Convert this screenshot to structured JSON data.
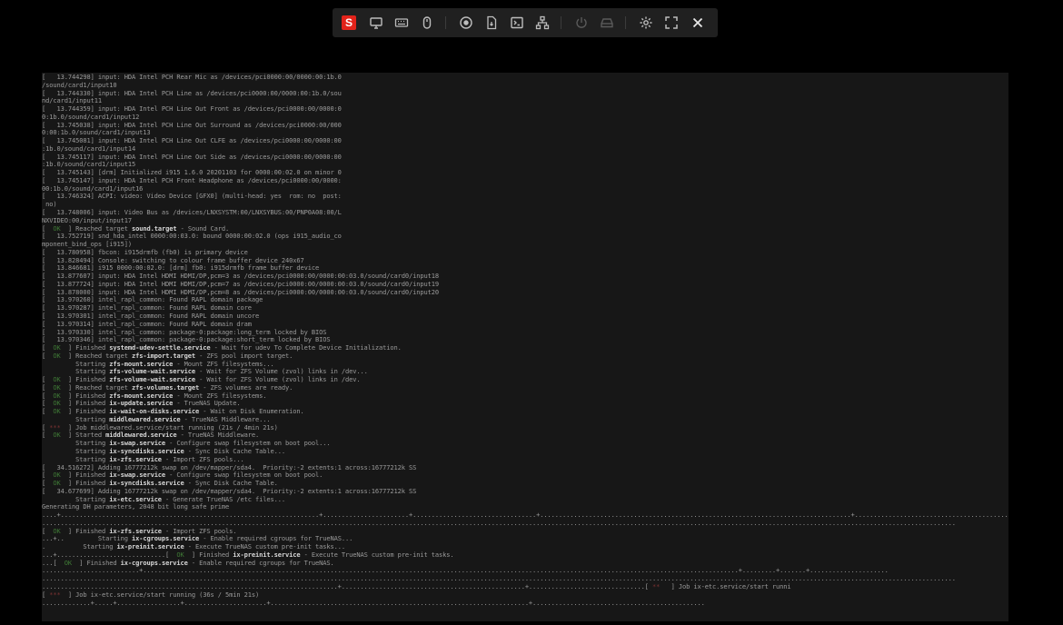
{
  "toolbar": {
    "logo_letter": "S",
    "buttons": [
      "display-icon",
      "keyboard-icon",
      "mouse-icon",
      "record-icon",
      "file-transfer-icon",
      "terminal-icon",
      "network-icon",
      "power-icon",
      "drive-icon",
      "settings-icon",
      "fullscreen-icon",
      "close-icon"
    ]
  },
  "colors": {
    "console_bg": "#171717",
    "console_text": "#9a9a9a",
    "ok_green": "#3f7a36",
    "wait_red": "#7a3232",
    "logo_red": "#e2231a"
  },
  "console": {
    "lines": [
      [
        {
          "t": "[   13.744298] input: HDA Intel PCH Rear Mic as /devices/pci0000:00/0000:00:1b.0"
        }
      ],
      [
        {
          "t": "/sound/card1/input10"
        }
      ],
      [
        {
          "t": "[   13.744330] input: HDA Intel PCH Line as /devices/pci0000:00/0000:00:1b.0/sou"
        }
      ],
      [
        {
          "t": "nd/card1/input11"
        }
      ],
      [
        {
          "t": "[   13.744359] input: HDA Intel PCH Line Out Front as /devices/pci0000:00/0000:0"
        }
      ],
      [
        {
          "t": "0:1b.0/sound/card1/input12"
        }
      ],
      [
        {
          "t": "[   13.745038] input: HDA Intel PCH Line Out Surround as /devices/pci0000:00/000"
        }
      ],
      [
        {
          "t": "0:00:1b.0/sound/card1/input13"
        }
      ],
      [
        {
          "t": "[   13.745081] input: HDA Intel PCH Line Out CLFE as /devices/pci0000:00/0000:00"
        }
      ],
      [
        {
          "t": ":1b.0/sound/card1/input14"
        }
      ],
      [
        {
          "t": "[   13.745117] input: HDA Intel PCH Line Out Side as /devices/pci0000:00/0000:00"
        }
      ],
      [
        {
          "t": ":1b.0/sound/card1/input15"
        }
      ],
      [
        {
          "t": "[   13.745143] [drm] Initialized i915 1.6.0 20201103 for 0000:00:02.0 on minor 0"
        }
      ],
      [
        {
          "t": "[   13.745147] input: HDA Intel PCH Front Headphone as /devices/pci0000:00/0000:"
        }
      ],
      [
        {
          "t": "00:1b.0/sound/card1/input16"
        }
      ],
      [
        {
          "t": "[   13.746324] ACPI: video: Video Device [GFX0] (multi-head: yes  rom: no  post:"
        }
      ],
      [
        {
          "t": " no)"
        }
      ],
      [
        {
          "t": "[   13.748006] input: Video Bus as /devices/LNXSYSTM:00/LNXSYBUS:00/PNP0A08:00/L"
        }
      ],
      [
        {
          "t": "NXVIDEO:00/input/input17"
        }
      ],
      [
        {
          "t": "[  "
        },
        {
          "t": "OK",
          "c": "ok"
        },
        {
          "t": "  ] Reached target "
        },
        {
          "t": "sound.target",
          "c": "b"
        },
        {
          "t": " - Sound Card."
        }
      ],
      [
        {
          "t": "[   13.752719] snd_hda_intel 0000:00:03.0: bound 0000:00:02.0 (ops i915_audio_co"
        }
      ],
      [
        {
          "t": "mponent_bind_ops [i915])"
        }
      ],
      [
        {
          "t": "[   13.780958] fbcon: i915drmfb (fb0) is primary device"
        }
      ],
      [
        {
          "t": "[   13.828494] Console: switching to colour frame buffer device 240x67"
        }
      ],
      [
        {
          "t": "[   13.846681] i915 0000:00:02.0: [drm] fb0: i915drmfb frame buffer device"
        }
      ],
      [
        {
          "t": "[   13.877607] input: HDA Intel HDMI HDMI/DP,pcm=3 as /devices/pci0000:00/0000:00:03.0/sound/card0/input18"
        }
      ],
      [
        {
          "t": "[   13.877724] input: HDA Intel HDMI HDMI/DP,pcm=7 as /devices/pci0000:00/0000:00:03.0/sound/card0/input19"
        }
      ],
      [
        {
          "t": "[   13.878000] input: HDA Intel HDMI HDMI/DP,pcm=8 as /devices/pci0000:00/0000:00:03.0/sound/card0/input20"
        }
      ],
      [
        {
          "t": "[   13.970260] intel_rapl_common: Found RAPL domain package"
        }
      ],
      [
        {
          "t": "[   13.970287] intel_rapl_common: Found RAPL domain core"
        }
      ],
      [
        {
          "t": "[   13.970301] intel_rapl_common: Found RAPL domain uncore"
        }
      ],
      [
        {
          "t": "[   13.970314] intel_rapl_common: Found RAPL domain dram"
        }
      ],
      [
        {
          "t": "[   13.970330] intel_rapl_common: package-0:package:long_term locked by BIOS"
        }
      ],
      [
        {
          "t": "[   13.970346] intel_rapl_common: package-0:package:short_term locked by BIOS"
        }
      ],
      [
        {
          "t": "[  "
        },
        {
          "t": "OK",
          "c": "ok"
        },
        {
          "t": "  ] Finished "
        },
        {
          "t": "systemd-udev-settle.service",
          "c": "b"
        },
        {
          "t": " - Wait for udev To Complete Device Initialization."
        }
      ],
      [
        {
          "t": "[  "
        },
        {
          "t": "OK",
          "c": "ok"
        },
        {
          "t": "  ] Reached target "
        },
        {
          "t": "zfs-import.target",
          "c": "b"
        },
        {
          "t": " - ZFS pool import target."
        }
      ],
      [
        {
          "t": "         Starting "
        },
        {
          "t": "zfs-mount.service",
          "c": "b"
        },
        {
          "t": " - Mount ZFS filesystems..."
        }
      ],
      [
        {
          "t": "         Starting "
        },
        {
          "t": "zfs-volume-wait.service",
          "c": "b"
        },
        {
          "t": " - Wait for ZFS Volume (zvol) links in /dev..."
        }
      ],
      [
        {
          "t": "[  "
        },
        {
          "t": "OK",
          "c": "ok"
        },
        {
          "t": "  ] Finished "
        },
        {
          "t": "zfs-volume-wait.service",
          "c": "b"
        },
        {
          "t": " - Wait for ZFS Volume (zvol) links in /dev."
        }
      ],
      [
        {
          "t": "[  "
        },
        {
          "t": "OK",
          "c": "ok"
        },
        {
          "t": "  ] Reached target "
        },
        {
          "t": "zfs-volumes.target",
          "c": "b"
        },
        {
          "t": " - ZFS volumes are ready."
        }
      ],
      [
        {
          "t": "[  "
        },
        {
          "t": "OK",
          "c": "ok"
        },
        {
          "t": "  ] Finished "
        },
        {
          "t": "zfs-mount.service",
          "c": "b"
        },
        {
          "t": " - Mount ZFS filesystems."
        }
      ],
      [
        {
          "t": "[  "
        },
        {
          "t": "OK",
          "c": "ok"
        },
        {
          "t": "  ] Finished "
        },
        {
          "t": "ix-update.service",
          "c": "b"
        },
        {
          "t": " - TrueNAS Update."
        }
      ],
      [
        {
          "t": "[  "
        },
        {
          "t": "OK",
          "c": "ok"
        },
        {
          "t": "  ] Finished "
        },
        {
          "t": "ix-wait-on-disks.service",
          "c": "b"
        },
        {
          "t": " - Wait on Disk Enumeration."
        }
      ],
      [
        {
          "t": "         Starting "
        },
        {
          "t": "middlewared.service",
          "c": "b"
        },
        {
          "t": " - TrueNAS Middleware..."
        }
      ],
      [
        {
          "t": "[ "
        },
        {
          "t": "***",
          "c": "spin"
        },
        {
          "t": "  ] Job middlewared.service/start running (21s / 4min 21s)"
        }
      ],
      [
        {
          "t": "[  "
        },
        {
          "t": "OK",
          "c": "ok"
        },
        {
          "t": "  ] Started "
        },
        {
          "t": "middlewared.service",
          "c": "b"
        },
        {
          "t": " - TrueNAS Middleware."
        }
      ],
      [
        {
          "t": "         Starting "
        },
        {
          "t": "ix-swap.service",
          "c": "b"
        },
        {
          "t": " - Configure swap filesystem on boot pool..."
        }
      ],
      [
        {
          "t": "         Starting "
        },
        {
          "t": "ix-syncdisks.service",
          "c": "b"
        },
        {
          "t": " - Sync Disk Cache Table..."
        }
      ],
      [
        {
          "t": "         Starting "
        },
        {
          "t": "ix-zfs.service",
          "c": "b"
        },
        {
          "t": " - Import ZFS pools..."
        }
      ],
      [
        {
          "t": "[   34.516272] Adding 16777212k swap on /dev/mapper/sda4.  Priority:-2 extents:1 across:16777212k SS"
        }
      ],
      [
        {
          "t": "[  "
        },
        {
          "t": "OK",
          "c": "ok"
        },
        {
          "t": "  ] Finished "
        },
        {
          "t": "ix-swap.service",
          "c": "b"
        },
        {
          "t": " - Configure swap filesystem on boot pool."
        }
      ],
      [
        {
          "t": "[  "
        },
        {
          "t": "OK",
          "c": "ok"
        },
        {
          "t": "  ] Finished "
        },
        {
          "t": "ix-syncdisks.service",
          "c": "b"
        },
        {
          "t": " - Sync Disk Cache Table."
        }
      ],
      [
        {
          "t": "[   34.677699] Adding 16777212k swap on /dev/mapper/sda4.  Priority:-2 extents:1 across:16777212k SS"
        }
      ],
      [
        {
          "t": "         Starting "
        },
        {
          "t": "ix-etc.service",
          "c": "b"
        },
        {
          "t": " - Generate TrueNAS /etc files..."
        }
      ],
      [
        {
          "t": "Generating DH parameters, 2048 bit long safe prime"
        }
      ],
      [
        {
          "t": "....+.....................................................................+.......................+.................................+...................................................................................+..........................................................."
        }
      ],
      [
        {
          "t": "...................................................................................................................................................................................................................................................."
        }
      ],
      [
        {
          "t": "[  "
        },
        {
          "t": "OK",
          "c": "ok"
        },
        {
          "t": "  ] Finished "
        },
        {
          "t": "ix-zfs.service",
          "c": "b"
        },
        {
          "t": " - Import ZFS pools."
        }
      ],
      [
        {
          "t": "...+..         Starting "
        },
        {
          "t": "ix-cgroups.service",
          "c": "b"
        },
        {
          "t": " - Enable required cgroups for TrueNAS..."
        }
      ],
      [
        {
          "t": ".          Starting "
        },
        {
          "t": "ix-preinit.service",
          "c": "b"
        },
        {
          "t": " - Execute TrueNAS custom pre-init tasks..."
        }
      ],
      [
        {
          "t": "...+.............................[  "
        },
        {
          "t": "OK",
          "c": "ok"
        },
        {
          "t": "  ] Finished "
        },
        {
          "t": "ix-preinit.service",
          "c": "b"
        },
        {
          "t": " - Execute TrueNAS custom pre-init tasks."
        }
      ],
      [
        {
          "t": "...[  "
        },
        {
          "t": "OK",
          "c": "ok"
        },
        {
          "t": "  ] Finished "
        },
        {
          "t": "ix-cgroups.service",
          "c": "b"
        },
        {
          "t": " - Enable required cgroups for TrueNAS."
        }
      ],
      [
        {
          "t": "..........................+...............................................................................................................................................................+.........+.......+....................."
        }
      ],
      [
        {
          "t": "...................................................................................................................................................................................................................................................."
        }
      ],
      [
        {
          "t": "...............................................................................+.................................................+...............................[ "
        },
        {
          "t": "**",
          "c": "spin"
        },
        {
          "t": "   ] Job ix-etc.service/start runni"
        }
      ],
      [
        {
          "t": "[ "
        },
        {
          "t": "***",
          "c": "spin"
        },
        {
          "t": "  ] Job ix-etc.service/start running (36s / 5min 21s)"
        }
      ],
      [
        {
          "t": ".............+.....+.................+......................+.....................................................................+.............................................."
        }
      ]
    ]
  }
}
